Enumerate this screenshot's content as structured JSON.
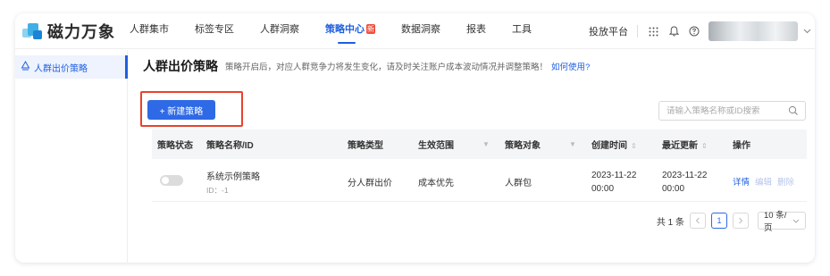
{
  "brand": {
    "name": "磁力万象"
  },
  "nav": {
    "items": [
      {
        "label": "人群集市"
      },
      {
        "label": "标签专区"
      },
      {
        "label": "人群洞察"
      },
      {
        "label": "策略中心",
        "badge": "新",
        "active": true
      },
      {
        "label": "数据洞察"
      },
      {
        "label": "报表"
      },
      {
        "label": "工具"
      }
    ],
    "right": {
      "platform_label": "投放平台",
      "icons": [
        "apps-grid-icon",
        "bell-icon",
        "help-icon"
      ]
    }
  },
  "sidebar": {
    "items": [
      {
        "label": "人群出价策略",
        "icon": "strategy-icon",
        "active": true
      }
    ]
  },
  "main": {
    "title": "人群出价策略",
    "description": "策略开启后，对应人群竞争力将发生变化，请及时关注账户成本波动情况并调整策略！",
    "help_link": "如何使用?",
    "new_button": "+ 新建策略",
    "search": {
      "placeholder": "请输入策略名称或ID搜索"
    }
  },
  "table": {
    "columns": [
      "策略状态",
      "策略名称/ID",
      "策略类型",
      "生效范围",
      "策略对象",
      "创建时间",
      "最近更新",
      "操作"
    ],
    "rows": [
      {
        "status_on": false,
        "name": "系统示例策略",
        "id_text": "ID：-1",
        "type": "分人群出价",
        "scope": "成本优先",
        "target": "人群包",
        "created_date": "2023-11-22",
        "created_time": "00:00",
        "updated_date": "2023-11-22",
        "updated_time": "00:00",
        "actions": {
          "detail": "详情",
          "edit": "编辑",
          "delete": "删除"
        }
      }
    ]
  },
  "pagination": {
    "total_text": "共 1 条",
    "current_page": "1",
    "page_size": "10 条/页"
  },
  "colors": {
    "accent": "#1f5fe0",
    "button": "#2f6ae6",
    "highlight": "#e8432c",
    "badge": "#f0503d"
  }
}
